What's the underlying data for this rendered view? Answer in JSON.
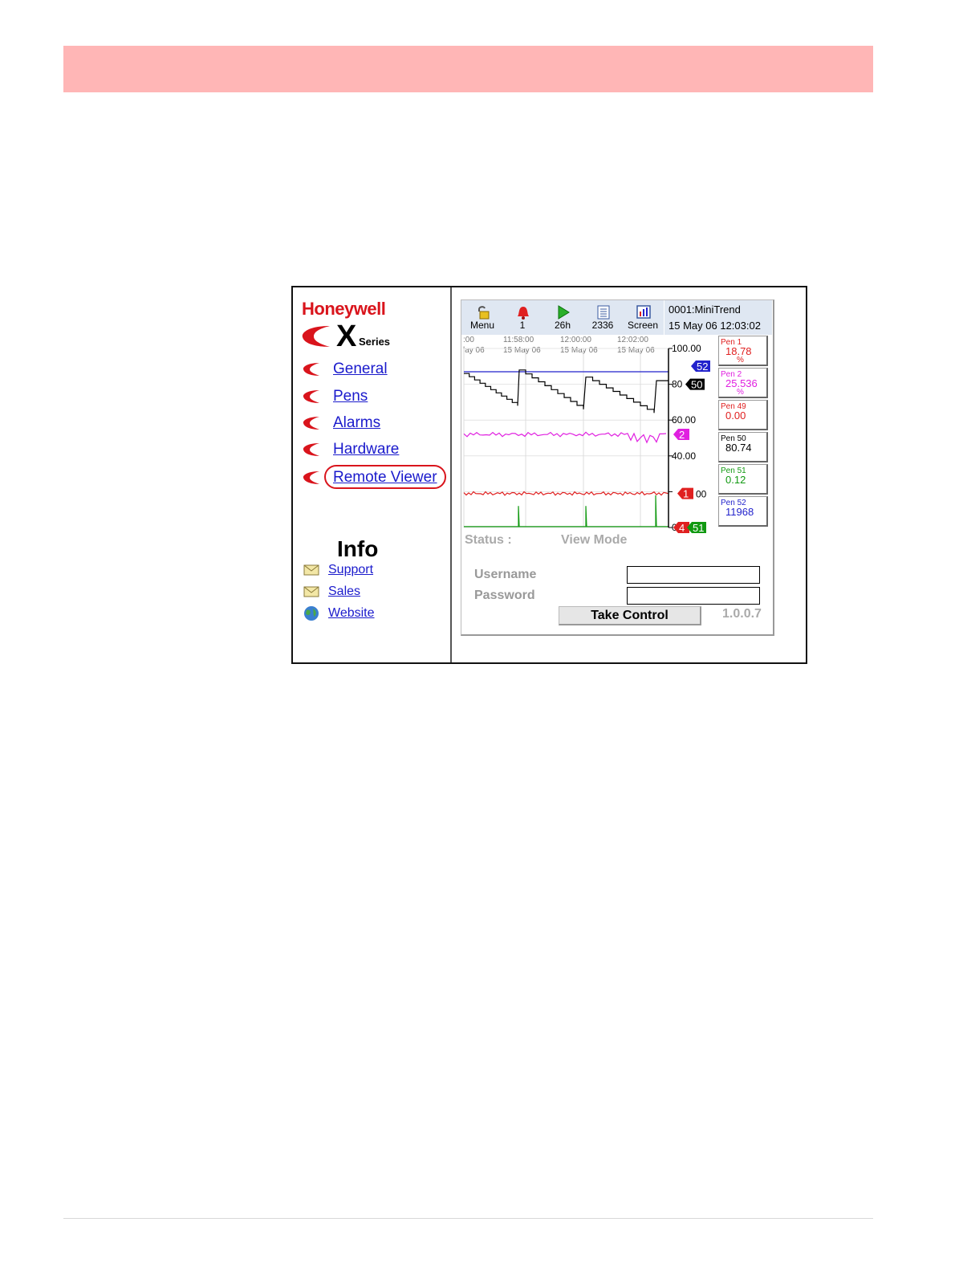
{
  "brand": {
    "company": "Honeywell",
    "product_letter": "X",
    "product_word": "Series",
    "red": "#d9141c"
  },
  "nav": {
    "items": [
      {
        "label": "General"
      },
      {
        "label": "Pens"
      },
      {
        "label": "Alarms"
      },
      {
        "label": "Hardware"
      },
      {
        "label": "Remote Viewer",
        "highlighted": true
      }
    ]
  },
  "info": {
    "title": "Info",
    "items": [
      {
        "label": "Support",
        "icon": "envelope-icon"
      },
      {
        "label": "Sales",
        "icon": "envelope-icon"
      },
      {
        "label": "Website",
        "icon": "globe-icon"
      }
    ]
  },
  "toolbar": {
    "buttons": [
      {
        "label": "Menu",
        "icon": "padlock-icon"
      },
      {
        "label": "1",
        "icon": "alarm-bell-icon"
      },
      {
        "label": "26h",
        "icon": "play-icon"
      },
      {
        "label": "2336",
        "icon": "list-icon"
      },
      {
        "label": "Screen",
        "icon": "screen-chart-icon"
      }
    ],
    "device_name": "0001:MiniTrend",
    "datetime": "15 May 06  12:03:02"
  },
  "timeline": {
    "labels": [
      {
        "time": ":00",
        "date": "lay 06"
      },
      {
        "time": "11:58:00",
        "date": "15 May 06"
      },
      {
        "time": "12:00:00",
        "date": "15 May 06"
      },
      {
        "time": "12:02:00",
        "date": "15 May 06"
      }
    ]
  },
  "chart_data": {
    "type": "line",
    "title": "",
    "ylim": [
      0,
      100
    ],
    "y_ticks": [
      "100.00",
      "80",
      "60.00",
      "40.00",
      "",
      "0."
    ],
    "grid": true,
    "series": [
      {
        "name": "52",
        "color": "#2222cc"
      },
      {
        "name": "50",
        "color": "#000000"
      },
      {
        "name": "2",
        "color": "#e020e0"
      },
      {
        "name": "1",
        "color": "#e02020"
      },
      {
        "name": "51",
        "color": "#119911"
      }
    ],
    "markers": [
      {
        "label": "52",
        "value": 87,
        "color": "#2222cc"
      },
      {
        "label": "50",
        "value": 80,
        "color": "#000000"
      },
      {
        "label": "2",
        "value": 52,
        "color": "#e020e0"
      },
      {
        "label": "1",
        "value": 19,
        "color": "#e02020"
      },
      {
        "label": "4",
        "value": 0,
        "color": "#e02020"
      },
      {
        "label": "51",
        "value": 0,
        "color": "#119911"
      }
    ],
    "marker_tick_fragments": {
      "m1": "00"
    }
  },
  "pens": [
    {
      "name": "Pen 1",
      "value": "18.78",
      "unit": "%",
      "color": "#e02020"
    },
    {
      "name": "Pen 2",
      "value": "25.536",
      "unit": "%",
      "color": "#e020e0"
    },
    {
      "name": "Pen 49",
      "value": "0.00",
      "unit": "",
      "color": "#e02020"
    },
    {
      "name": "Pen 50",
      "value": "80.74",
      "unit": "",
      "color": "#000000"
    },
    {
      "name": "Pen 51",
      "value": "0.12",
      "unit": "",
      "color": "#119911"
    },
    {
      "name": "Pen 52",
      "value": "11968",
      "unit": "",
      "color": "#2222cc"
    }
  ],
  "status": {
    "label": "Status :",
    "value": "View Mode"
  },
  "login": {
    "username_label": "Username",
    "password_label": "Password",
    "username_value": "",
    "password_value": "",
    "button_label": "Take Control",
    "version": "1.0.0.7"
  }
}
